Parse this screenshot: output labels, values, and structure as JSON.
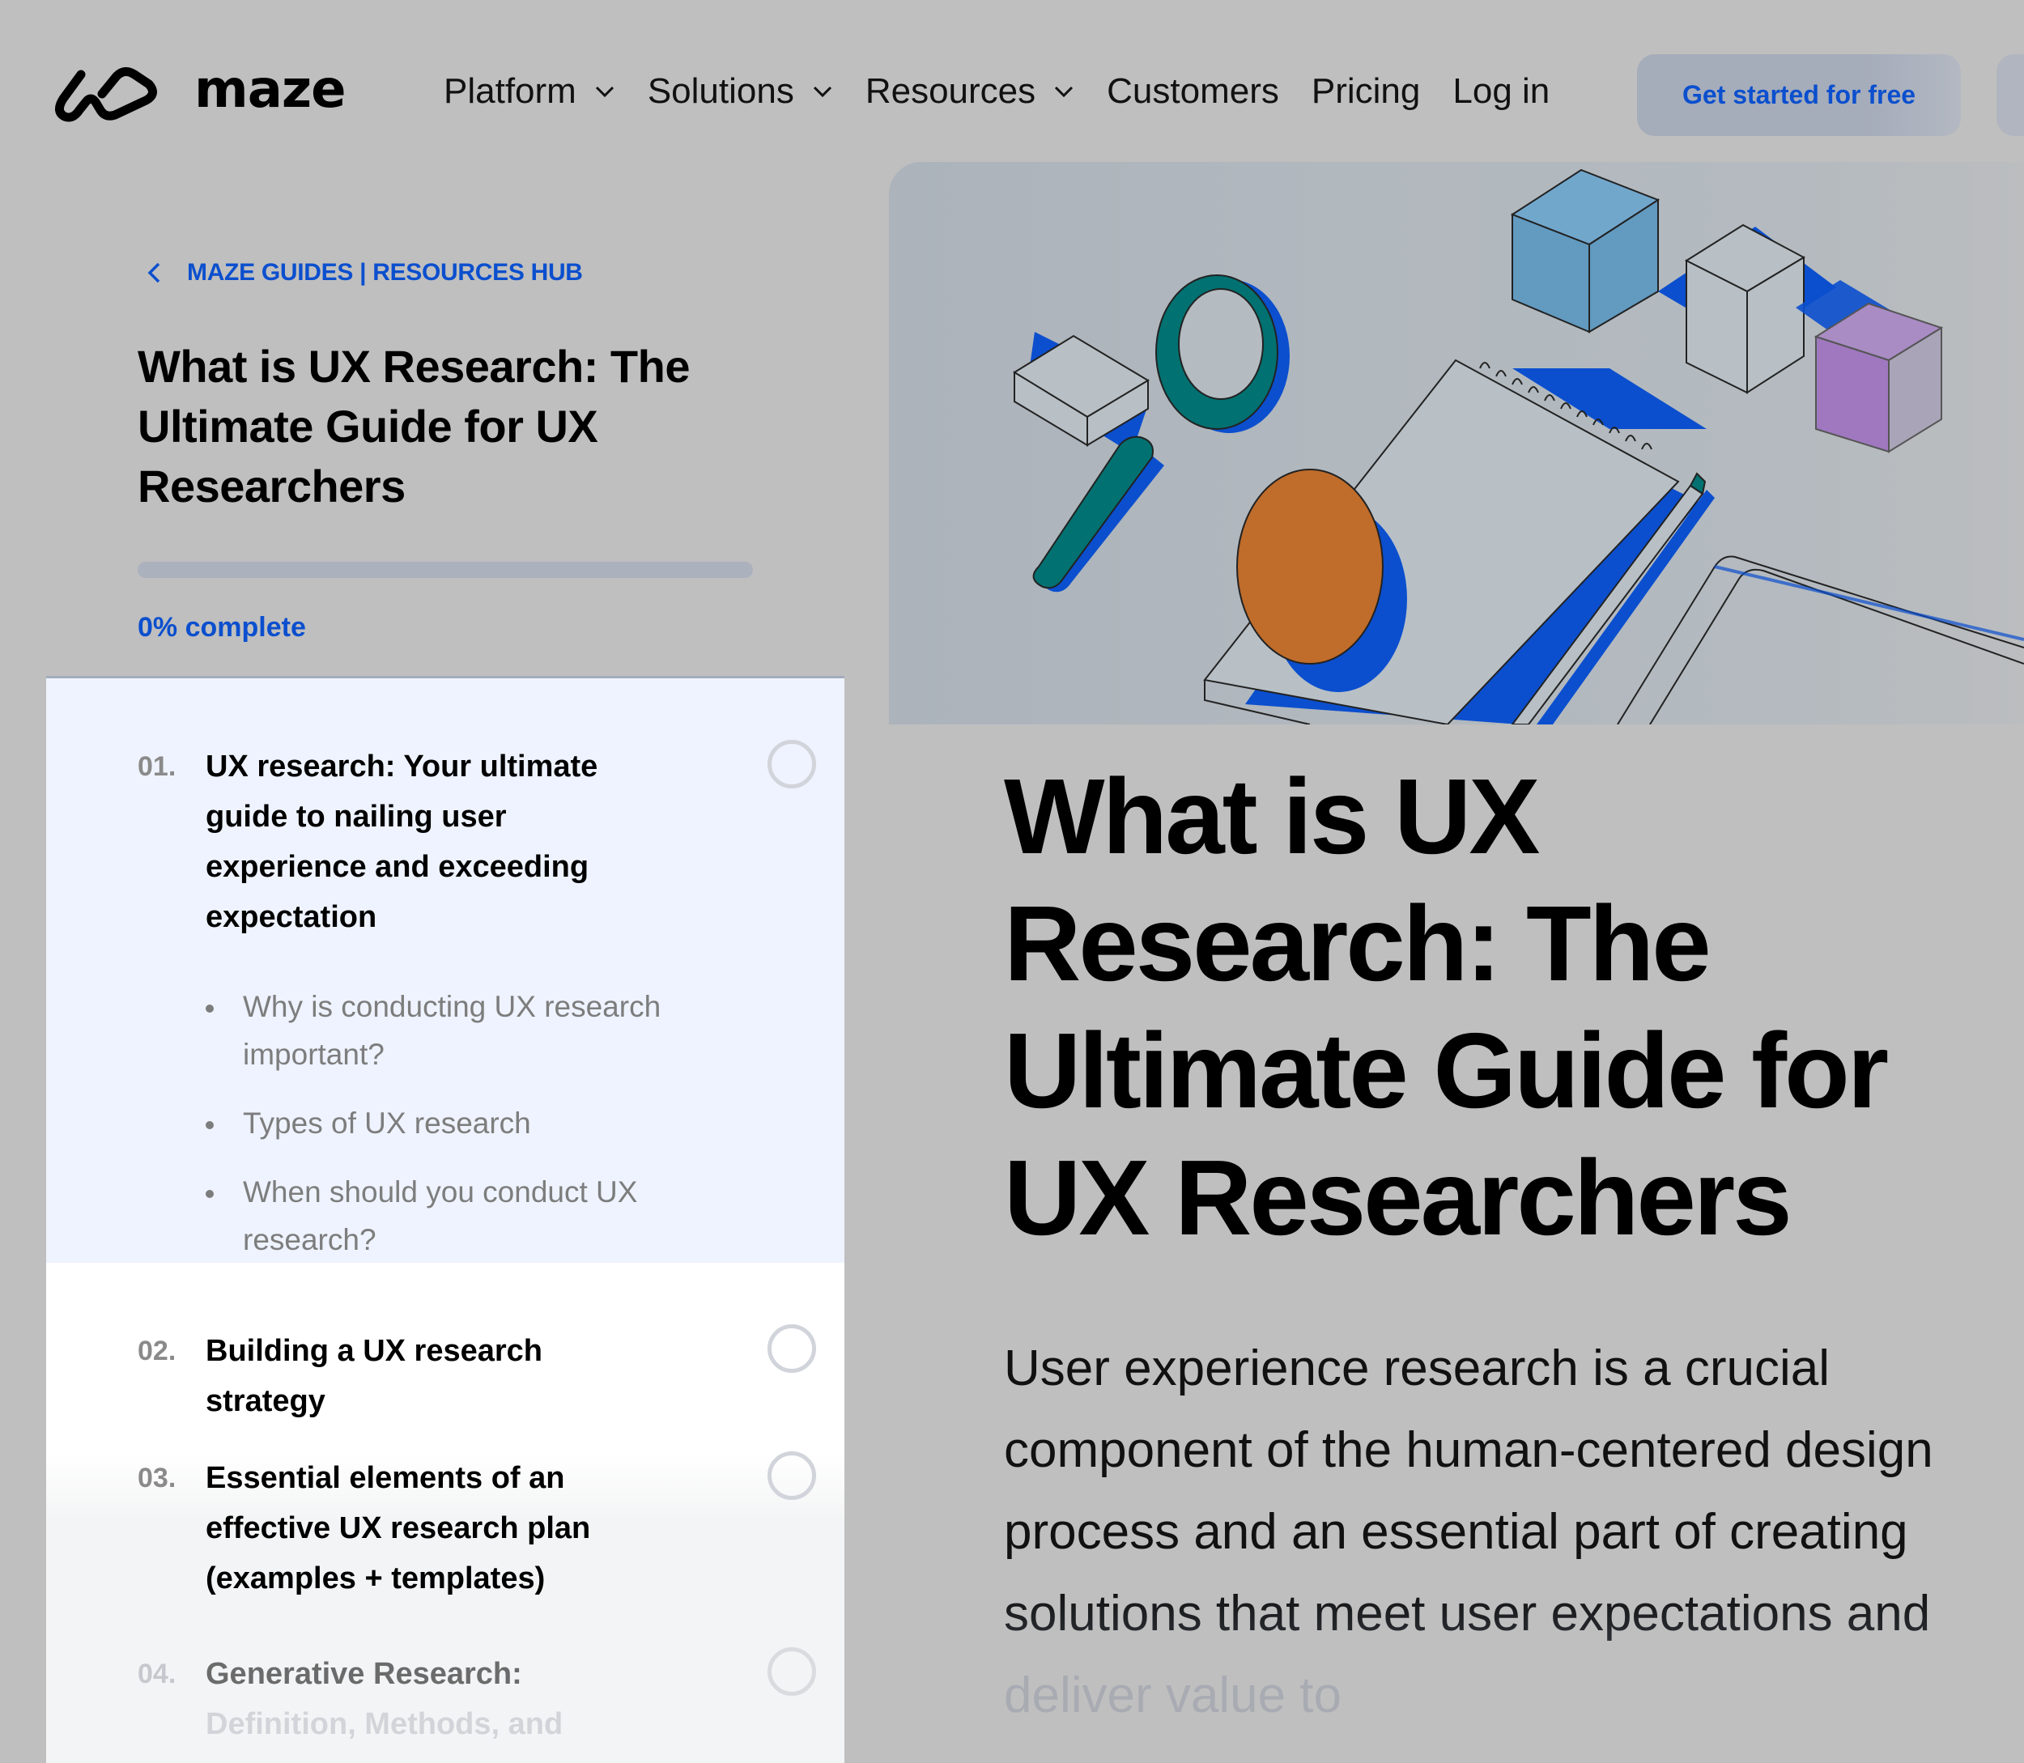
{
  "brand": {
    "name": "maze",
    "logo_icon": "maze-logo-icon"
  },
  "nav": {
    "items": [
      {
        "label": "Platform",
        "has_dropdown": true
      },
      {
        "label": "Solutions",
        "has_dropdown": true
      },
      {
        "label": "Resources",
        "has_dropdown": true
      },
      {
        "label": "Customers",
        "has_dropdown": false
      },
      {
        "label": "Pricing",
        "has_dropdown": false
      },
      {
        "label": "Log in",
        "has_dropdown": false
      }
    ],
    "cta_label": "Get started for free"
  },
  "sidebar": {
    "breadcrumb": "MAZE GUIDES | RESOURCES HUB",
    "title": "What is UX Research: The Ultimate Guide for UX Researchers",
    "progress_percent": 0,
    "progress_label": "0% complete",
    "chapters": [
      {
        "number": "01.",
        "title": "UX research: Your ultimate guide to nailing user experience and exceeding expectation",
        "active": true,
        "completed": false,
        "subsections": [
          "Why is conducting UX research important?",
          "Types of UX research",
          "When should you conduct UX research?"
        ]
      },
      {
        "number": "02.",
        "title": "Building a UX research strategy",
        "active": false,
        "completed": false
      },
      {
        "number": "03.",
        "title": "Essential elements of an effective UX research plan (examples + templates)",
        "active": false,
        "completed": false
      },
      {
        "number": "04.",
        "title": "Generative Research: Definition, Methods, and",
        "active": false,
        "completed": false
      }
    ]
  },
  "article": {
    "hero_alt": "Isometric illustration of a magnifying glass, notebook, orange disc, pen and cubes",
    "title": "What is UX Research: The Ultimate Guide for UX Researchers",
    "intro": "User experience research is a crucial component of the human-centered design process and an essential part of creating solutions that meet user expectations and deliver value to"
  },
  "colors": {
    "accent": "#0b4fce",
    "page_overlay": "#bfbfbf",
    "active_chapter_bg": "#eef3ff",
    "progress_track": "#abb1bd",
    "teal": "#017171",
    "orange": "#c06c2a",
    "cube_blue": "#629ac0",
    "cube_purple": "#a078bf"
  }
}
